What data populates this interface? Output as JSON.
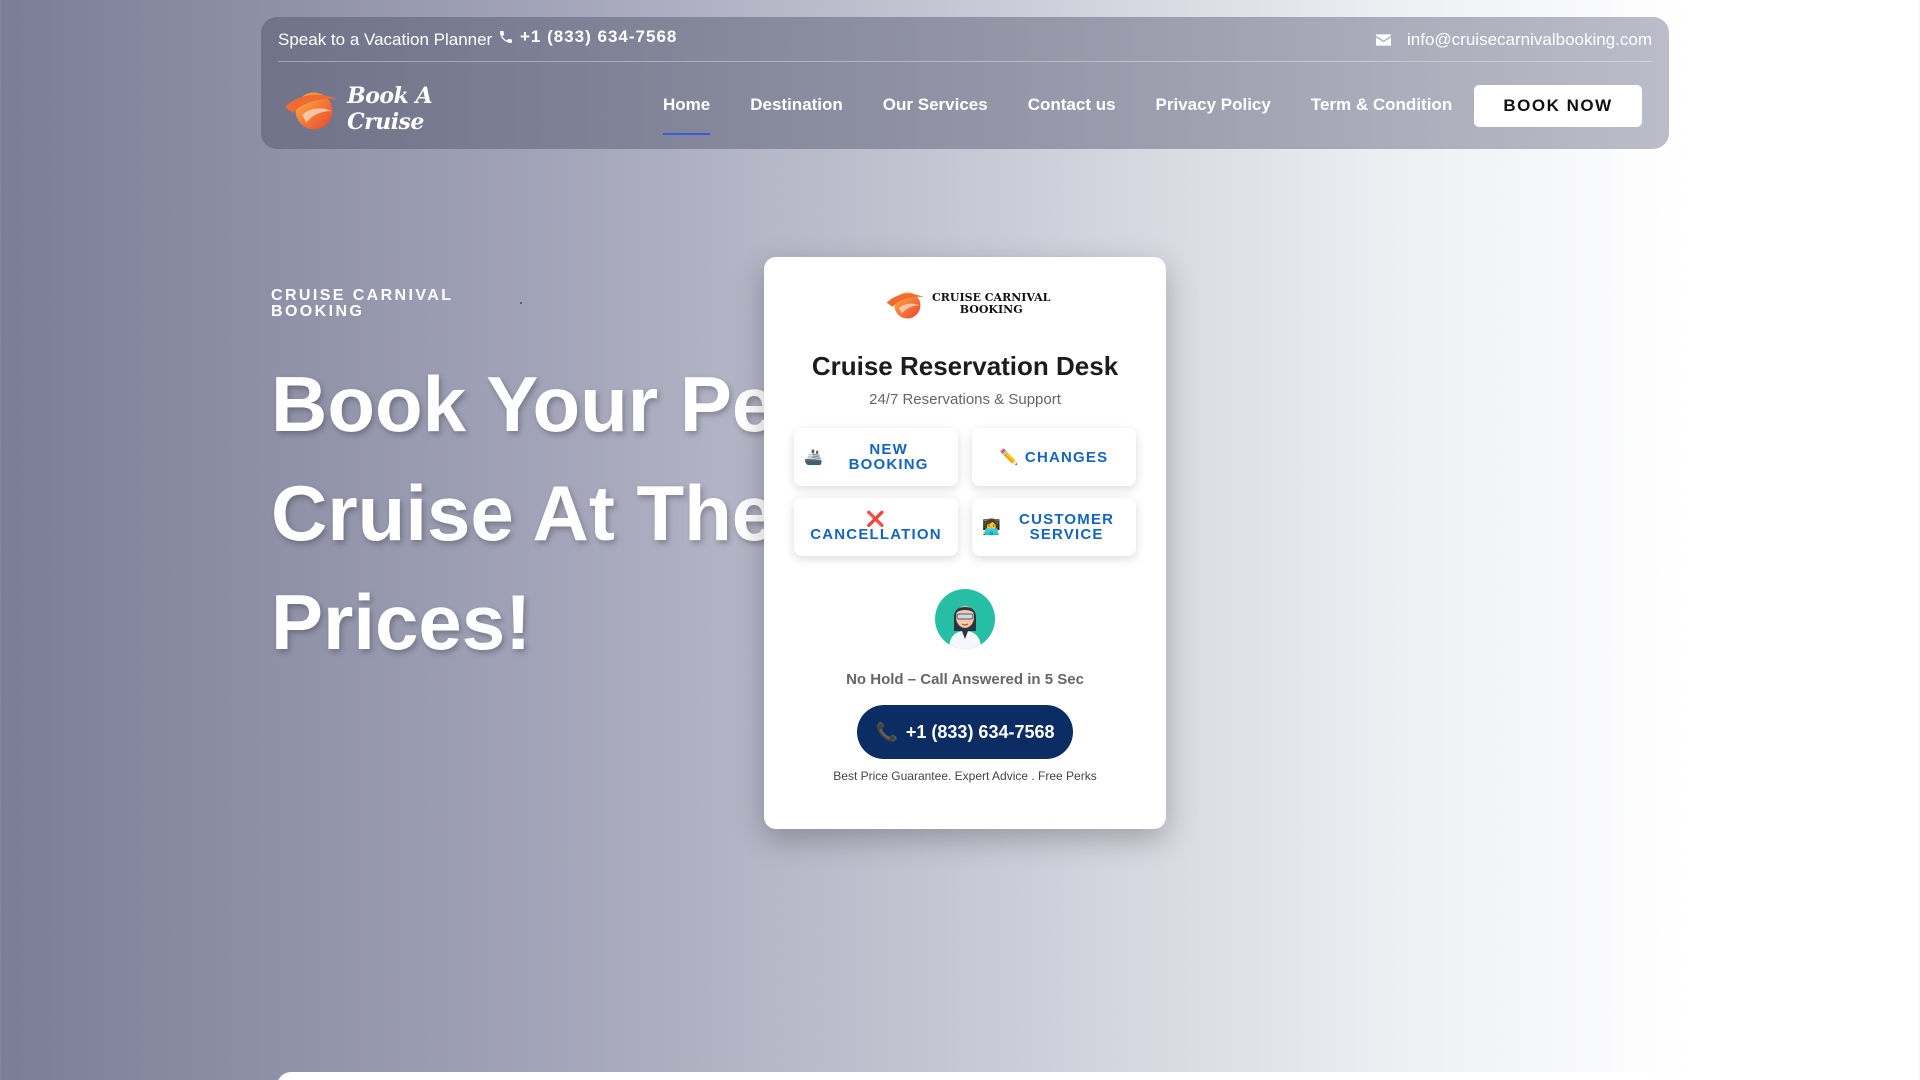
{
  "topbar": {
    "planner_text": "Speak to a Vacation Planner",
    "phone": "+1 (833) 634-7568",
    "email": "info@cruisecarnivalbooking.com"
  },
  "logo": {
    "text": "Book A Cruise"
  },
  "nav": {
    "items": [
      {
        "label": "Home",
        "active": true
      },
      {
        "label": "Destination"
      },
      {
        "label": "Our Services"
      },
      {
        "label": "Contact us"
      },
      {
        "label": "Privacy Policy"
      },
      {
        "label": "Term & Condition"
      }
    ],
    "book_now": "BOOK NOW"
  },
  "hero": {
    "eyebrow": "CRUISE CARNIVAL BOOKING",
    "title": "Book Your Pe\nCruise At The\nPrices!"
  },
  "card": {
    "logo_text": "CRUISE CARNIVAL\nBOOKING",
    "title": "Cruise Reservation Desk",
    "subtitle": "24/7 Reservations & Support",
    "services": [
      {
        "icon": "🚢",
        "label": "New Booking"
      },
      {
        "icon": "✏️",
        "label": "Changes"
      },
      {
        "icon": "❌",
        "label": "Cancellation"
      },
      {
        "icon": "👩‍💻",
        "label": "Customer Service"
      }
    ],
    "no_hold": "No Hold – Call Answered in 5 Sec",
    "call_icon": "📞",
    "call_number": "+1 (833) 634-7568",
    "guarantee": "Best Price Guarantee. Expert Advice . Free Perks"
  },
  "colors": {
    "accent": "#3b5bdb",
    "service_text": "#1565c0",
    "call_button": "#0b2d63",
    "avatar_bg": "#26bfa5"
  }
}
